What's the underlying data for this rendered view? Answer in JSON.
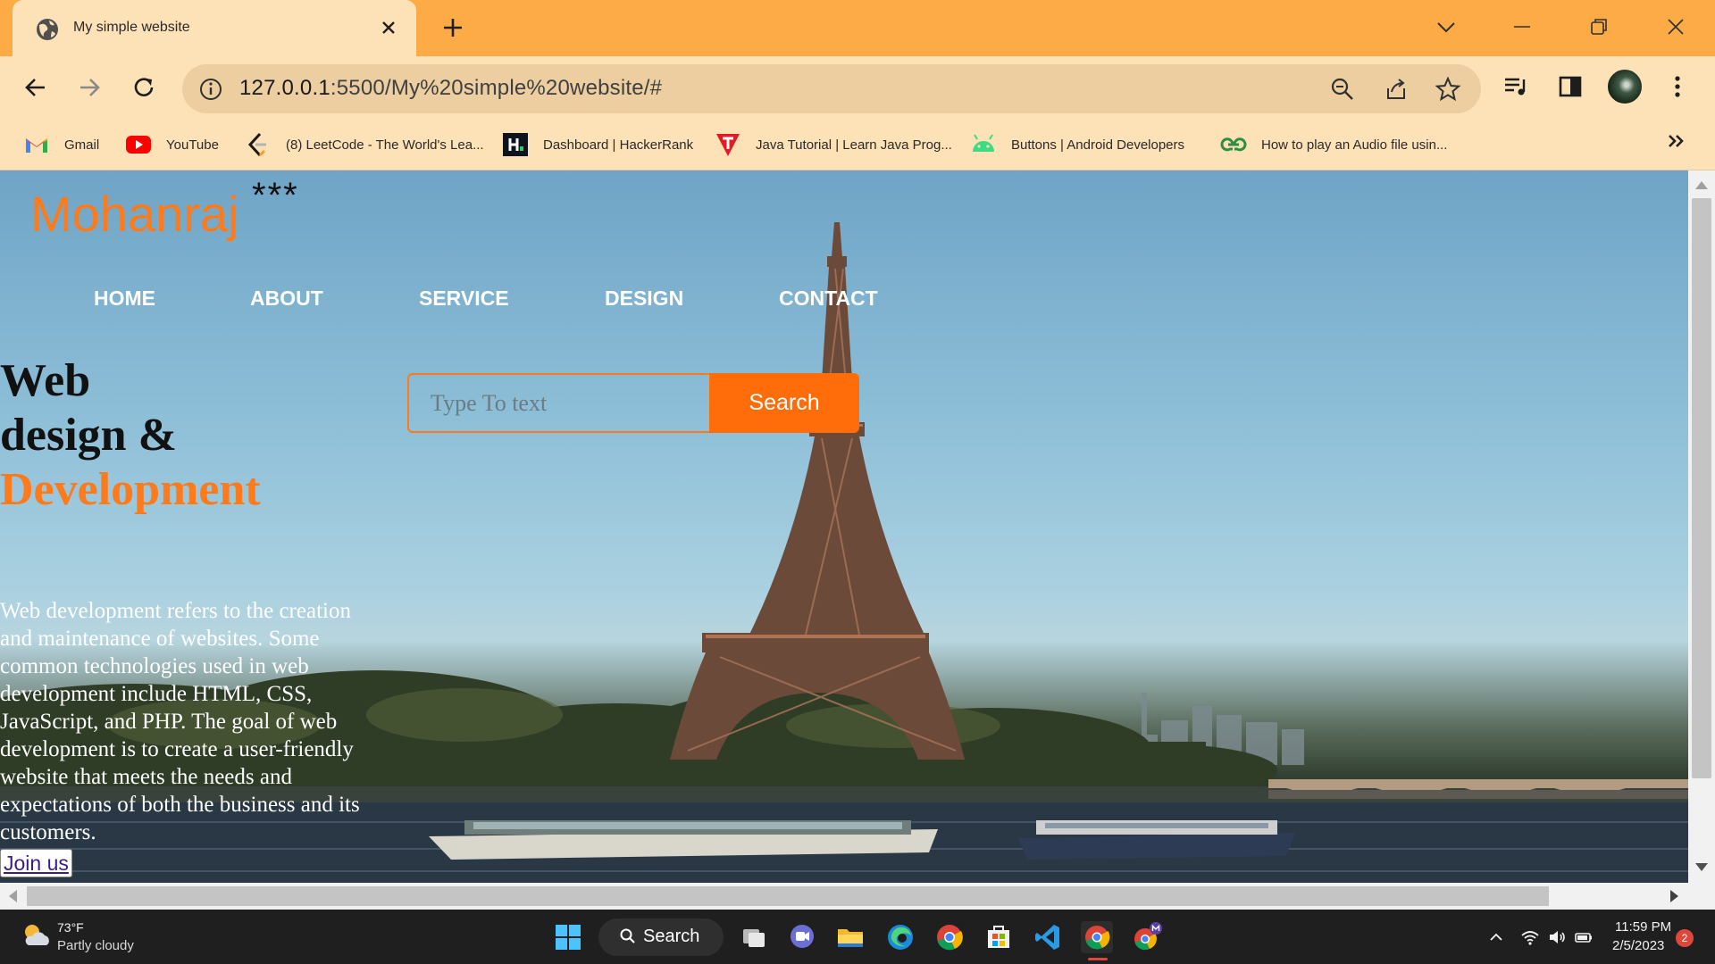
{
  "browser": {
    "tab_title": "My simple website",
    "url_host": "127.0.0.1",
    "url_rest": ":5500/My%20simple%20website/#",
    "bookmarks": [
      {
        "label": "Gmail",
        "icon": "gmail-icon"
      },
      {
        "label": "YouTube",
        "icon": "youtube-icon"
      },
      {
        "label": "(8) LeetCode - The World's Lea...",
        "icon": "leetcode-icon"
      },
      {
        "label": "Dashboard | HackerRank",
        "icon": "hackerrank-icon"
      },
      {
        "label": "Java Tutorial | Learn Java Prog...",
        "icon": "tutorial-icon"
      },
      {
        "label": "Buttons | Android Developers",
        "icon": "android-icon"
      },
      {
        "label": "How to play an Audio file usin...",
        "icon": "geeksforgeeks-icon"
      }
    ],
    "colors": {
      "tabbar": "#fdab47",
      "toolbar": "#fde1b7",
      "omnibox": "#eccea0"
    }
  },
  "site": {
    "logo": "Mohanraj",
    "logo_stars": "***",
    "nav": [
      "HOME",
      "ABOUT",
      "SERVICE",
      "DESIGN",
      "CONTACT"
    ],
    "search_placeholder": "Type To text",
    "search_button": "Search",
    "hero_line1": "Web",
    "hero_line2": "design &",
    "hero_accent": "Development",
    "hero_body": "Web development refers to the creation and maintenance of websites. Some common technologies used in web development include HTML, CSS, JavaScript, and PHP. The goal of web development is to create a user-friendly website that meets the needs and expectations of both the business and its customers.",
    "join_button": "Join us",
    "colors": {
      "accent": "#ff7a1a",
      "button": "#ff6d0a"
    }
  },
  "taskbar": {
    "weather_temp": "73°F",
    "weather_desc": "Partly cloudy",
    "search_label": "Search",
    "time": "11:59 PM",
    "date": "2/5/2023",
    "notifications": "2"
  }
}
